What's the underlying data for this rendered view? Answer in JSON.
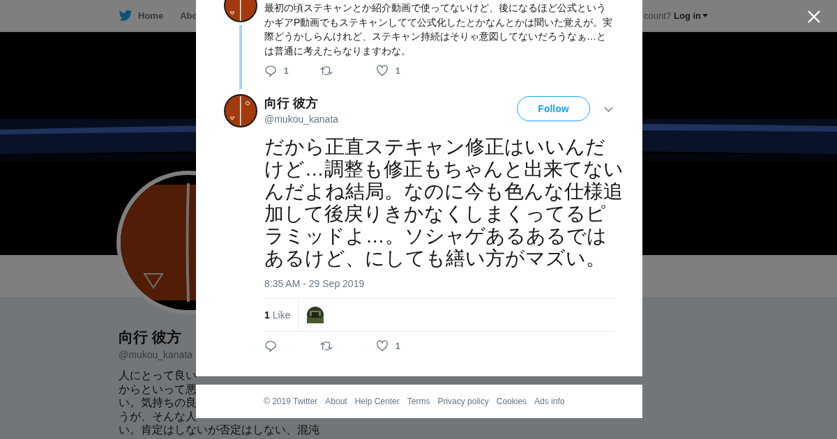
{
  "nav": {
    "items": [
      {
        "label": "Home"
      },
      {
        "label": "Abo"
      }
    ],
    "account_prompt": "count?",
    "login": "Log in"
  },
  "profile": {
    "name": "向行 彼方",
    "handle": "@mukou_kanata",
    "bio_lines": [
      "人にとって良い",
      "からといって悪",
      "い。気持ちの良",
      "うが、そんな人",
      "い。肯定はしないが否定はしない、混沌"
    ]
  },
  "thread": [
    {
      "text": "最初の頃ステキャンとか紹介動画で使ってないけど、後になるほど公式というかギアP動画でもステキャンしてて公式化したとかなんとかは聞いた覚えが。実際どうかしらんけれど、ステキャン持続はそりゃ意図してないだろうなぁ…とは普通に考えたらなりますわな。",
      "reply_count": "1",
      "like_count": "1"
    }
  ],
  "tweet": {
    "name": "向行 彼方",
    "handle": "@mukou_kanata",
    "follow": "Follow",
    "text_lines": [
      "だから正直ステキャン修正はいいんだ",
      "けど…調整も修正もちゃんと出来てない",
      "んだよね結局。なのに今も色んな仕様追",
      "加して後戻りきかなくしまくってるピ",
      "ラミッドよ…。ソシャゲあるあるでは",
      "あるけど、にしても繕い方がマズい。"
    ],
    "time": "8:35 AM - 29 Sep 2019",
    "likes_count": "1",
    "likes_label": "Like",
    "like_count": "1"
  },
  "footer": [
    "© 2019 Twitter",
    "About",
    "Help Center",
    "Terms",
    "Privacy policy",
    "Cookies",
    "Ads info"
  ]
}
